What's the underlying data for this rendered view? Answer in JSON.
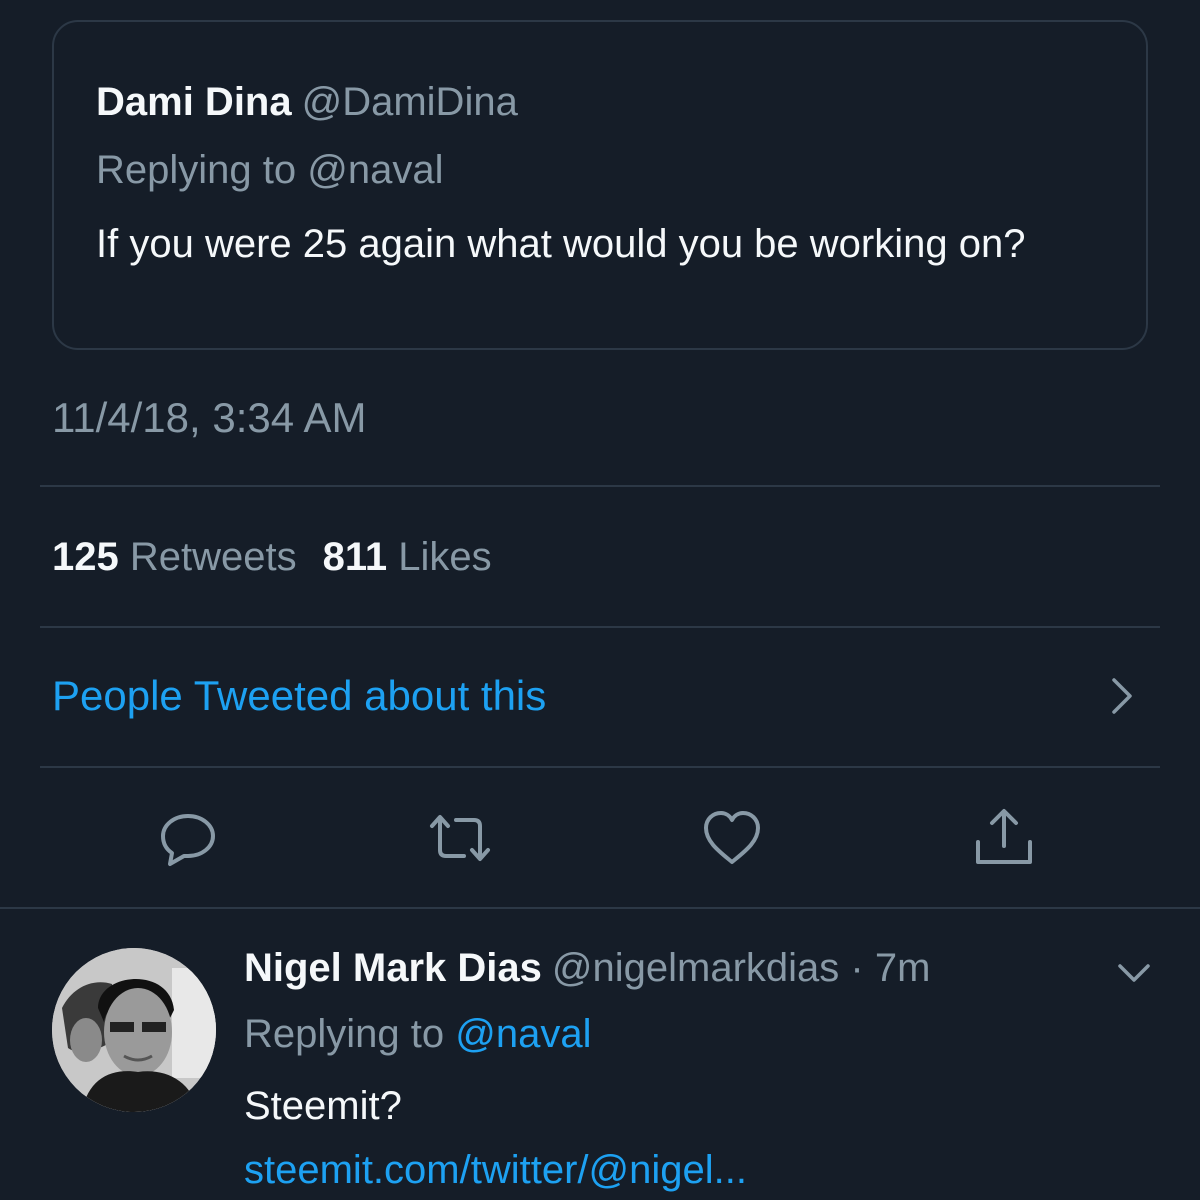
{
  "quoted_tweet": {
    "author_name": "Dami Dina",
    "author_handle": "@DamiDina",
    "replying_prefix": "Replying to",
    "replying_to": "@naval",
    "text": "If you were 25 again what would you be working on?"
  },
  "tweet": {
    "timestamp": "11/4/18, 3:34 AM",
    "retweets_count": "125",
    "retweets_label": "Retweets",
    "likes_count": "811",
    "likes_label": "Likes",
    "people_tweeted_link": "People Tweeted about this"
  },
  "actions": {
    "icons": [
      "reply-icon",
      "retweet-icon",
      "like-icon",
      "share-icon"
    ]
  },
  "reply": {
    "author_name": "Nigel Mark Dias",
    "author_handle": "@nigelmarkdias",
    "time_separator": "·",
    "time_ago": "7m",
    "replying_prefix": "Replying to",
    "replying_to": "@naval",
    "text": "Steemit?",
    "link": "steemit.com/twitter/@nigel..."
  },
  "colors": {
    "background": "#151d28",
    "divider": "#2c3846",
    "primary_text": "#f5f8fa",
    "secondary_text": "#8899a6",
    "accent": "#1da1f2"
  }
}
